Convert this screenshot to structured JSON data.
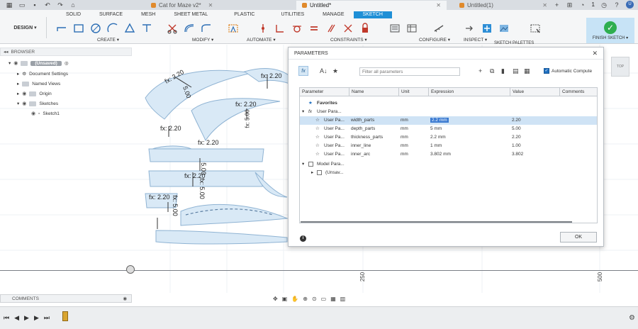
{
  "titlebar": {
    "tabs": [
      {
        "label": "Cat for Maze v2*",
        "active": false
      },
      {
        "label": "Untitled*",
        "active": true
      },
      {
        "label": "Untitled(1)",
        "active": false
      }
    ],
    "notifications": "1"
  },
  "ribbon": {
    "workspace_tabs": [
      "SOLID",
      "SURFACE",
      "MESH",
      "SHEET METAL",
      "PLASTIC",
      "UTILITIES",
      "MANAGE",
      "SKETCH"
    ],
    "active_tab": "SKETCH",
    "design_label": "DESIGN ▾",
    "groups": [
      "CREATE ▾",
      "MODIFY ▾",
      "AUTOMATE ▾",
      "CONSTRAINTS ▾",
      "CONFIGURE ▾",
      "INSPECT ▾"
    ],
    "finish_sketch_label": "FINISH SKETCH ▾",
    "sketch_palettes_label": "SKETCH PALETTES"
  },
  "browser": {
    "title": "BROWSER",
    "root": "(Unsaved)",
    "items": [
      "Document Settings",
      "Named Views",
      "Origin",
      "Sketches",
      "Sketch1"
    ]
  },
  "canvas": {
    "dimension_labels": [
      "fx: 2.20",
      "5.00",
      "fx: 2.20",
      "fx: 2.20",
      "fx: 5.00",
      "fx: 2.20",
      "fx: 2.20",
      "5.00",
      "fx: 2.20",
      "fx: 5.00",
      "fx: 2.20",
      "fx: 5.00"
    ],
    "ruler_labels": [
      "250",
      "500"
    ]
  },
  "viewcube": {
    "label": "TOP"
  },
  "dialog": {
    "title": "PARAMETERS",
    "filter_placeholder": "Filter all parameters",
    "auto_compute_label": "Automatic Compute",
    "columns": [
      "Parameter",
      "Name",
      "Unit",
      "Expression",
      "Value",
      "Comments"
    ],
    "favorites_label": "Favorites",
    "user_group_label": "User Para...",
    "user_params": [
      {
        "parameter": "User Pa...",
        "name": "width_parts",
        "unit": "mm",
        "expression": "2.2 mm",
        "value": "2.20"
      },
      {
        "parameter": "User Pa...",
        "name": "depth_parts",
        "unit": "mm",
        "expression": "5 mm",
        "value": "5.00"
      },
      {
        "parameter": "User Pa...",
        "name": "thickness_parts",
        "unit": "mm",
        "expression": "2.2 mm",
        "value": "2.20"
      },
      {
        "parameter": "User Pa...",
        "name": "inner_line",
        "unit": "mm",
        "expression": "1 mm",
        "value": "1.00"
      },
      {
        "parameter": "User Pa...",
        "name": "inner_arc",
        "unit": "mm",
        "expression": "3.802 mm",
        "value": "3.802"
      }
    ],
    "model_group_label": "Model Para...",
    "model_child_label": "(Unsav...",
    "ok_label": "OK"
  },
  "bottom": {
    "comments_label": "COMMENTS"
  },
  "colors": {
    "accent": "#1f8fd6",
    "sketch_fill": "#d9e9f6",
    "sketch_stroke": "#8fb3d3",
    "selection": "#cfe3f5"
  }
}
